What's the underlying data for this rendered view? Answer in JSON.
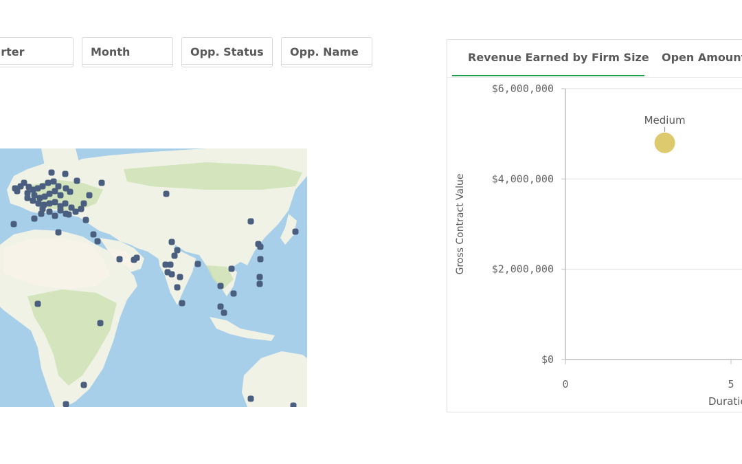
{
  "filters": [
    {
      "label": "uarter"
    },
    {
      "label": "Month"
    },
    {
      "label": "Opp. Status"
    },
    {
      "label": "Opp. Name"
    }
  ],
  "map": {
    "colors": {
      "ocean": "#a8cfe9",
      "land": "#f1f2e6",
      "vegetation": "#cfe2b4",
      "desert": "#f7f3e9",
      "point": "#4a5f7f"
    }
  },
  "tabs": [
    {
      "label": "Revenue Earned by Firm Size"
    },
    {
      "label": "Open Amount"
    }
  ],
  "chart_data": {
    "type": "scatter",
    "ylabel": "Gross Contract Value",
    "xlabel": "Duratio",
    "y_ticks": [
      "$6,000,000",
      "$4,000,000",
      "$2,000,000",
      "$0"
    ],
    "y_tick_values": [
      6000000,
      4000000,
      2000000,
      0
    ],
    "x_ticks": [
      "0",
      "5"
    ],
    "x_tick_values": [
      0,
      5
    ],
    "ylim": [
      0,
      6000000
    ],
    "xlim": [
      0,
      5
    ],
    "grid": true,
    "points": [
      {
        "label": "Medium",
        "x": 3,
        "y": 4800000
      }
    ],
    "colors": {
      "point": "#ddc96e",
      "grid": "#dedede",
      "axis": "#bdbdbd"
    }
  }
}
